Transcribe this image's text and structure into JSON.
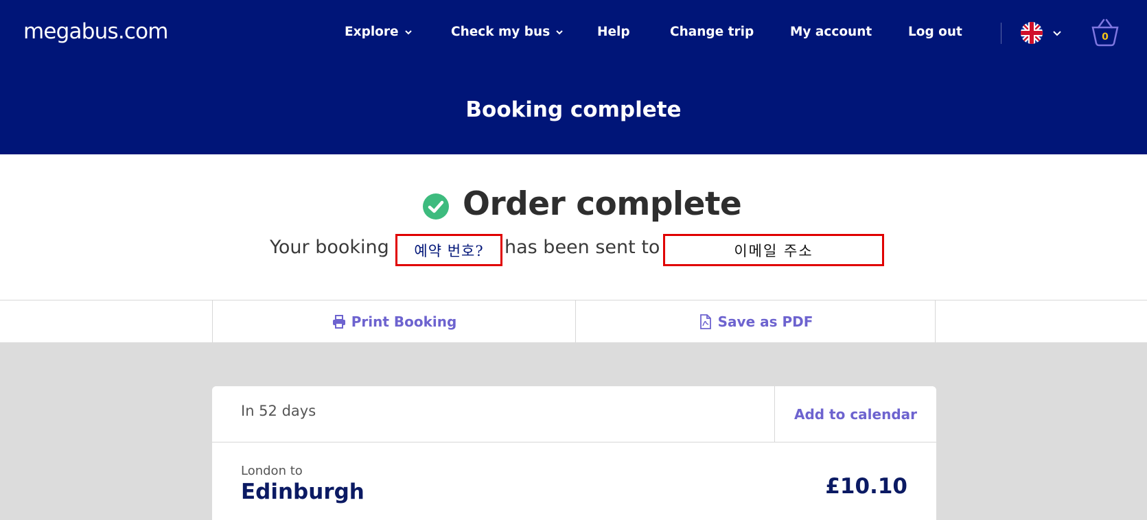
{
  "header": {
    "logo": "megabus.com",
    "nav": [
      {
        "label": "Explore",
        "has_dropdown": true
      },
      {
        "label": "Check my bus",
        "has_dropdown": true
      },
      {
        "label": "Help",
        "has_dropdown": false
      },
      {
        "label": "Change trip",
        "has_dropdown": false
      },
      {
        "label": "My account",
        "has_dropdown": false
      },
      {
        "label": "Log out",
        "has_dropdown": false
      }
    ],
    "language_icon": "uk-flag-icon",
    "basket_count": "0"
  },
  "hero": {
    "title": "Booking complete"
  },
  "confirmation": {
    "title": "Order complete",
    "line_prefix": "Your booking",
    "booking_ref_placeholder": "예약 번호?",
    "line_middle": "has been sent to",
    "email_placeholder": "이메일 주소",
    "status_color": "#3dbb7e"
  },
  "actions": {
    "print_label": "Print Booking",
    "pdf_label": "Save as PDF"
  },
  "trip": {
    "when": "In 52 days",
    "add_calendar": "Add to calendar",
    "origin_label": "London to",
    "destination": "Edinburgh",
    "price": "£10.10"
  },
  "colors": {
    "brand_navy": "#001578",
    "link_purple": "#6d63cf",
    "alert_red": "#e00000"
  }
}
